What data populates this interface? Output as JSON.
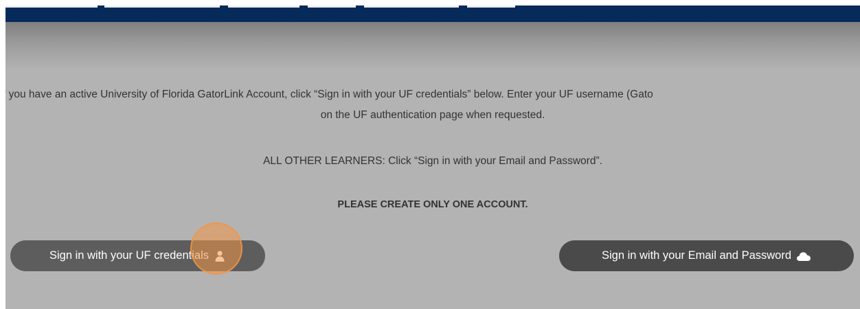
{
  "intro": {
    "line1": "f you have an active University of Florida GatorLink Account, click “Sign in with your UF credentials” below. Enter your UF username (Gato",
    "line2": "on the UF authentication page when requested."
  },
  "other_learners": "ALL OTHER LEARNERS: Click “Sign in with your Email and Password”.",
  "notice": "PLEASE CREATE ONLY ONE ACCOUNT.",
  "buttons": {
    "uf_label": "Sign in with your UF credentials",
    "uf_icon": "user-icon",
    "email_label": "Sign in with your Email and Password",
    "email_icon": "cloud-icon"
  },
  "colors": {
    "navbar": "#062a5a",
    "overlay": "#b3b3b3",
    "button_dark": "#4a4a4a",
    "click_marker": "#f0964a"
  }
}
